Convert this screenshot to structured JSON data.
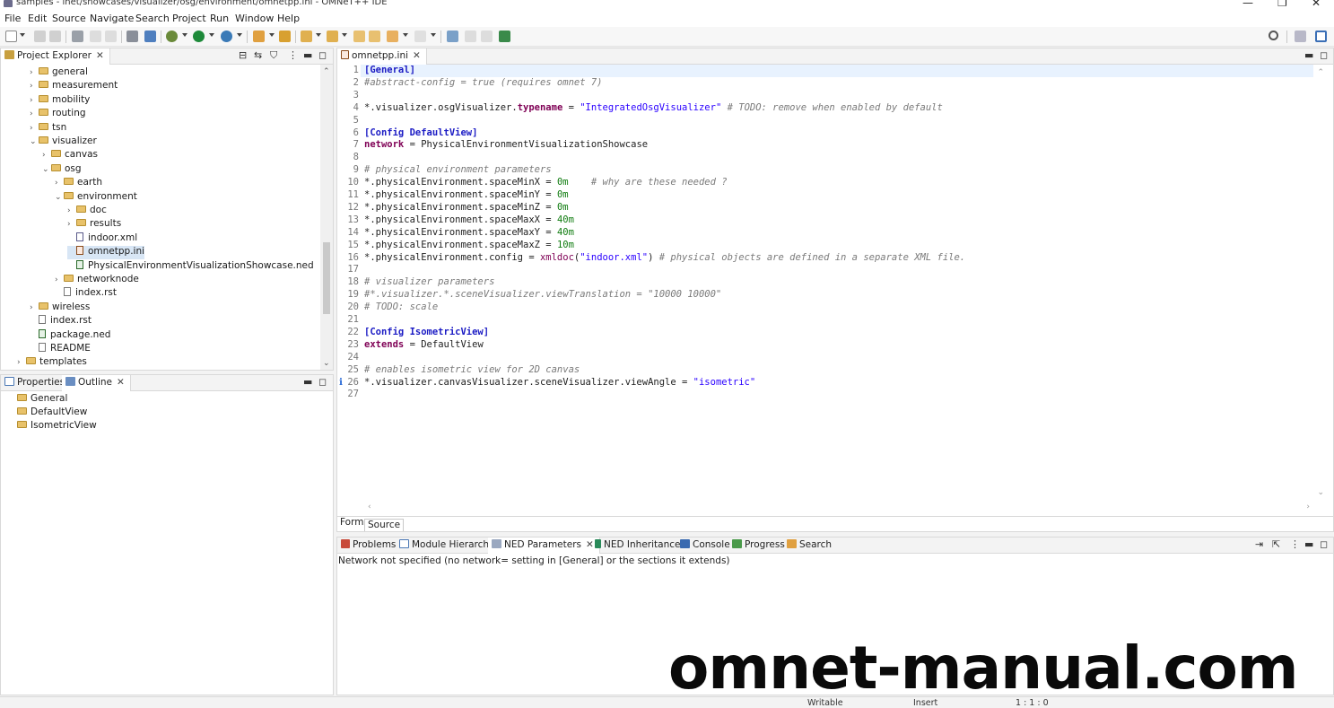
{
  "window": {
    "title": "samples - inet/showcases/visualizer/osg/environment/omnetpp.ini - OMNeT++ IDE",
    "minimize": "—",
    "restore": "❐",
    "close": "✕"
  },
  "menu": [
    "File",
    "Edit",
    "Source",
    "Navigate",
    "Search",
    "Project",
    "Run",
    "Window",
    "Help"
  ],
  "project_explorer": {
    "tab_label": "Project Explorer",
    "items": [
      {
        "label": "general",
        "type": "folder",
        "indent": 2,
        "expanded": false
      },
      {
        "label": "measurement",
        "type": "folder",
        "indent": 2,
        "expanded": false
      },
      {
        "label": "mobility",
        "type": "folder",
        "indent": 2,
        "expanded": false
      },
      {
        "label": "routing",
        "type": "folder",
        "indent": 2,
        "expanded": false
      },
      {
        "label": "tsn",
        "type": "folder",
        "indent": 2,
        "expanded": false
      },
      {
        "label": "visualizer",
        "type": "folder",
        "indent": 2,
        "expanded": true
      },
      {
        "label": "canvas",
        "type": "folder",
        "indent": 3,
        "expanded": false
      },
      {
        "label": "osg",
        "type": "folder",
        "indent": 3,
        "expanded": true
      },
      {
        "label": "earth",
        "type": "folder",
        "indent": 4,
        "expanded": false
      },
      {
        "label": "environment",
        "type": "folder",
        "indent": 4,
        "expanded": true
      },
      {
        "label": "doc",
        "type": "folder",
        "indent": 5,
        "expanded": false
      },
      {
        "label": "results",
        "type": "folder",
        "indent": 5,
        "expanded": false
      },
      {
        "label": "indoor.xml",
        "type": "xml",
        "indent": 5
      },
      {
        "label": "omnetpp.ini",
        "type": "ini",
        "indent": 5,
        "selected": true
      },
      {
        "label": "PhysicalEnvironmentVisualizationShowcase.ned",
        "type": "ned",
        "indent": 5
      },
      {
        "label": "networknode",
        "type": "folder",
        "indent": 4,
        "expanded": false
      },
      {
        "label": "index.rst",
        "type": "file",
        "indent": 4
      },
      {
        "label": "wireless",
        "type": "folder",
        "indent": 2,
        "expanded": false
      },
      {
        "label": "index.rst",
        "type": "file",
        "indent": 2
      },
      {
        "label": "package.ned",
        "type": "ned",
        "indent": 2
      },
      {
        "label": "README",
        "type": "file",
        "indent": 2
      },
      {
        "label": "templates",
        "type": "folder",
        "indent": 1,
        "expanded": false
      }
    ]
  },
  "outline": {
    "tabs": [
      "Properties",
      "Outline"
    ],
    "items": [
      "General",
      "DefaultView",
      "IsometricView"
    ]
  },
  "editor": {
    "tab_label": "omnetpp.ini",
    "lines": [
      {
        "n": "1",
        "tokens": [
          {
            "t": "[General]",
            "c": "sec"
          }
        ]
      },
      {
        "n": "2",
        "tokens": [
          {
            "t": "#abstract-config = true (requires omnet 7)",
            "c": "cmt"
          }
        ]
      },
      {
        "n": "3",
        "tokens": []
      },
      {
        "n": "4",
        "tokens": [
          {
            "t": "*.visualizer.osgVisualizer.",
            "c": "key"
          },
          {
            "t": "typename",
            "c": "kw"
          },
          {
            "t": " = ",
            "c": "key"
          },
          {
            "t": "\"IntegratedOsgVisualizer\"",
            "c": "str"
          },
          {
            "t": " # TODO: remove when enabled by default",
            "c": "cmt"
          }
        ]
      },
      {
        "n": "5",
        "tokens": []
      },
      {
        "n": "6",
        "tokens": [
          {
            "t": "[Config DefaultView]",
            "c": "sec"
          }
        ]
      },
      {
        "n": "7",
        "tokens": [
          {
            "t": "network",
            "c": "kw"
          },
          {
            "t": " = PhysicalEnvironmentVisualizationShowcase",
            "c": "key"
          }
        ]
      },
      {
        "n": "8",
        "tokens": []
      },
      {
        "n": "9",
        "tokens": [
          {
            "t": "# physical environment parameters",
            "c": "cmt"
          }
        ]
      },
      {
        "n": "10",
        "tokens": [
          {
            "t": "*.physicalEnvironment.spaceMinX = ",
            "c": "key"
          },
          {
            "t": "0m",
            "c": "num"
          },
          {
            "t": "    # why are these needed ?",
            "c": "cmt"
          }
        ]
      },
      {
        "n": "11",
        "tokens": [
          {
            "t": "*.physicalEnvironment.spaceMinY = ",
            "c": "key"
          },
          {
            "t": "0m",
            "c": "num"
          }
        ]
      },
      {
        "n": "12",
        "tokens": [
          {
            "t": "*.physicalEnvironment.spaceMinZ = ",
            "c": "key"
          },
          {
            "t": "0m",
            "c": "num"
          }
        ]
      },
      {
        "n": "13",
        "tokens": [
          {
            "t": "*.physicalEnvironment.spaceMaxX = ",
            "c": "key"
          },
          {
            "t": "40m",
            "c": "num"
          }
        ]
      },
      {
        "n": "14",
        "tokens": [
          {
            "t": "*.physicalEnvironment.spaceMaxY = ",
            "c": "key"
          },
          {
            "t": "40m",
            "c": "num"
          }
        ]
      },
      {
        "n": "15",
        "tokens": [
          {
            "t": "*.physicalEnvironment.spaceMaxZ = ",
            "c": "key"
          },
          {
            "t": "10m",
            "c": "num"
          }
        ]
      },
      {
        "n": "16",
        "tokens": [
          {
            "t": "*.physicalEnvironment.config = ",
            "c": "key"
          },
          {
            "t": "xmldoc",
            "c": "fn"
          },
          {
            "t": "(",
            "c": "key"
          },
          {
            "t": "\"indoor.xml\"",
            "c": "str"
          },
          {
            "t": ") ",
            "c": "key"
          },
          {
            "t": "# physical objects are defined in a separate XML file.",
            "c": "cmt"
          }
        ]
      },
      {
        "n": "17",
        "tokens": []
      },
      {
        "n": "18",
        "tokens": [
          {
            "t": "# visualizer parameters",
            "c": "cmt"
          }
        ]
      },
      {
        "n": "19",
        "tokens": [
          {
            "t": "#*.visualizer.*.sceneVisualizer.viewTranslation = \"10000 10000\"",
            "c": "cmt"
          }
        ]
      },
      {
        "n": "20",
        "tokens": [
          {
            "t": "# TODO: scale",
            "c": "cmt"
          }
        ]
      },
      {
        "n": "21",
        "tokens": []
      },
      {
        "n": "22",
        "tokens": [
          {
            "t": "[Config IsometricView]",
            "c": "sec"
          }
        ]
      },
      {
        "n": "23",
        "tokens": [
          {
            "t": "extends",
            "c": "kw"
          },
          {
            "t": " = DefaultView",
            "c": "key"
          }
        ]
      },
      {
        "n": "24",
        "tokens": []
      },
      {
        "n": "25",
        "tokens": [
          {
            "t": "# enables isometric view for 2D canvas",
            "c": "cmt"
          }
        ]
      },
      {
        "n": "26",
        "tokens": [
          {
            "t": "*.visualizer.canvasVisualizer.sceneVisualizer.viewAngle = ",
            "c": "key"
          },
          {
            "t": "\"isometric\"",
            "c": "str"
          }
        ],
        "marker": "i"
      },
      {
        "n": "27",
        "tokens": []
      }
    ],
    "subtabs": [
      "Form",
      "Source"
    ]
  },
  "bottom_panel": {
    "tabs": [
      "Problems",
      "Module Hierarchy",
      "NED Parameters",
      "NED Inheritance",
      "Console",
      "Progress",
      "Search"
    ],
    "message": "Network not specified (no network= setting in [General] or the sections it extends)"
  },
  "status": {
    "writable": "Writable",
    "mode": "Insert",
    "position": "1 : 1 : 0"
  },
  "watermark": "omnet-manual.com"
}
